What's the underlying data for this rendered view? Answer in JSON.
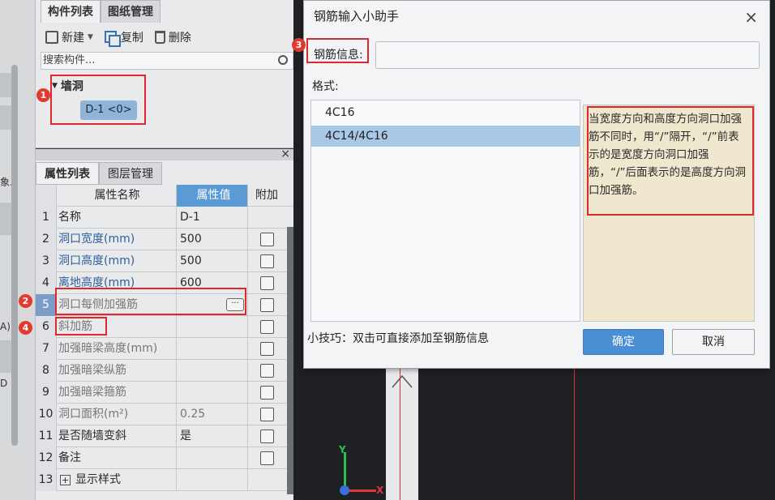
{
  "left_strip": {
    "labels": [
      "象.",
      "A)",
      "D"
    ]
  },
  "component_panel": {
    "tabs": [
      "构件列表",
      "图纸管理"
    ],
    "toolbar": {
      "new": "新建",
      "copy": "复制",
      "delete": "删除"
    },
    "search_placeholder": "搜索构件...",
    "tree": {
      "root": "墙洞",
      "leaf": "D-1 <0>"
    }
  },
  "properties_panel": {
    "tabs": [
      "属性列表",
      "图层管理"
    ],
    "headers": {
      "name": "属性名称",
      "value": "属性值",
      "add": "附加"
    },
    "rows": [
      {
        "num": "1",
        "name": "名称",
        "value": "D-1",
        "checkbox": false
      },
      {
        "num": "2",
        "name": "洞口宽度(mm)",
        "value": "500",
        "checkbox": true
      },
      {
        "num": "3",
        "name": "洞口高度(mm)",
        "value": "500",
        "checkbox": true
      },
      {
        "num": "4",
        "name": "离地高度(mm)",
        "value": "600",
        "checkbox": true
      },
      {
        "num": "5",
        "name": "洞口每侧加强筋",
        "value": "",
        "checkbox": true
      },
      {
        "num": "6",
        "name": "斜加筋",
        "value": "",
        "checkbox": true
      },
      {
        "num": "7",
        "name": "加强暗梁高度(mm)",
        "value": "",
        "checkbox": true
      },
      {
        "num": "8",
        "name": "加强暗梁纵筋",
        "value": "",
        "checkbox": true
      },
      {
        "num": "9",
        "name": "加强暗梁箍筋",
        "value": "",
        "checkbox": true
      },
      {
        "num": "10",
        "name": "洞口面积(m²)",
        "value": "0.25",
        "checkbox": true
      },
      {
        "num": "11",
        "name": "是否随墙变斜",
        "value": "是",
        "checkbox": true
      },
      {
        "num": "12",
        "name": "备注",
        "value": "",
        "checkbox": true
      },
      {
        "num": "13",
        "name": "显示样式",
        "value": "",
        "checkbox": false
      }
    ],
    "expand_symbol": "+",
    "ellipsis": "···"
  },
  "canvas": {
    "axis_y": "Y",
    "axis_x": "X"
  },
  "dialog": {
    "title": "钢筋输入小助手",
    "close": "×",
    "info_label": "钢筋信息:",
    "info_value": "",
    "format_label": "格式:",
    "formats": [
      "4C16",
      "4C14/4C16"
    ],
    "selected_format": 1,
    "description": "当宽度方向和高度方向洞口加强筋不同时，用“/”隔开，“/”前表示的是宽度方向洞口加强筋，“/”后面表示的是高度方向洞口加强筋。",
    "tip": "小技巧：双击可直接添加至钢筋信息",
    "ok": "确定",
    "cancel": "取消"
  },
  "annotations": [
    "1",
    "2",
    "3",
    "4"
  ],
  "colors": {
    "accent": "#5a9bd5",
    "highlight": "#e0282c",
    "selected": "#a9c8e8"
  }
}
